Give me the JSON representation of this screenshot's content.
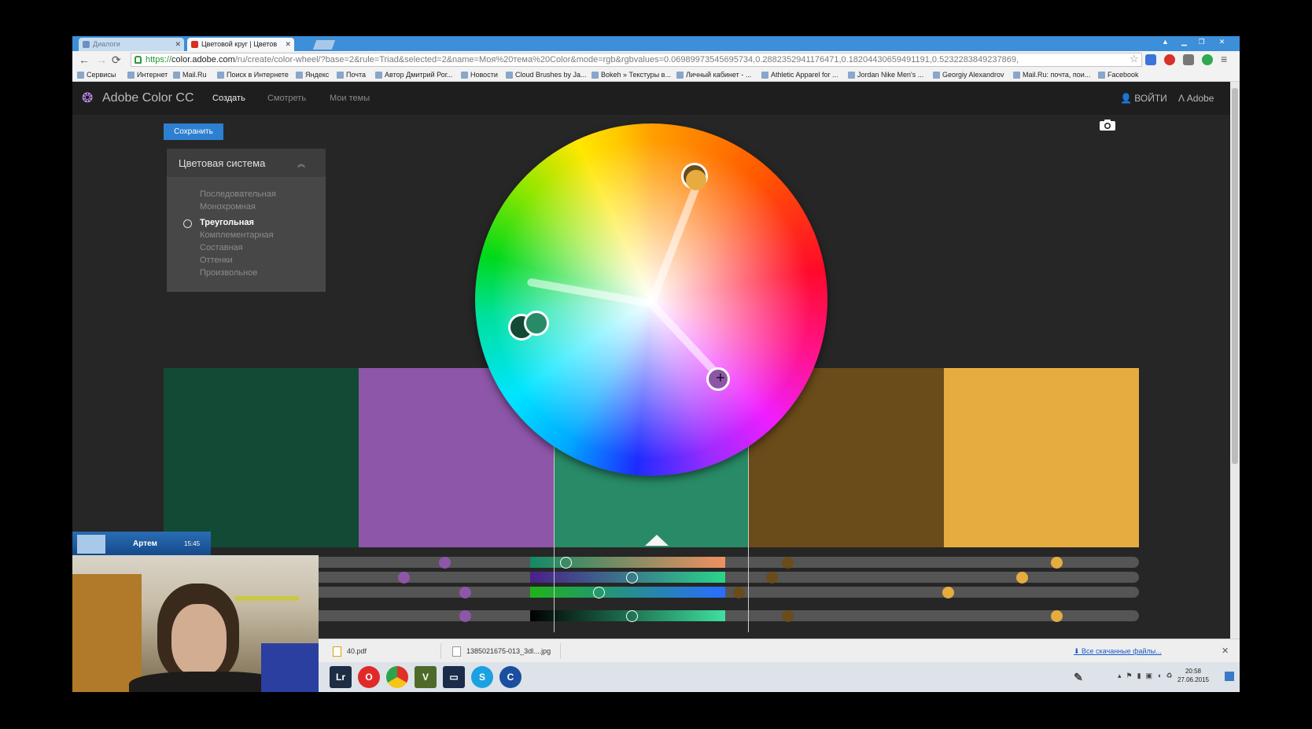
{
  "browser": {
    "tabs": [
      {
        "label": "Диалоги"
      },
      {
        "label": "Цветовой круг | Цветов"
      }
    ],
    "url_scheme": "https://",
    "url_host": "color.adobe.com",
    "url_rest": "/ru/create/color-wheel/?base=2&rule=Triad&selected=2&name=Моя%20тема%20Color&mode=rgb&rgbvalues=0.06989973545695734,0.2882352941176471,0.18204430659491191,0.5232283849237869,",
    "bookmarks": [
      "Сервисы",
      "Интернет",
      "Mail.Ru",
      "Поиск в Интернете",
      "Яндекс",
      "Почта",
      "Автор Дмитрий Рог...",
      "Новости",
      "Cloud Brushes by Ja...",
      "Bokeh » Текстуры в...",
      "Личный кабинет - ...",
      "Athletic Apparel for ...",
      "Jordan Nike Men's ...",
      "Georgiy Alexandrov",
      "Mail.Ru: почта, пои...",
      "Facebook"
    ]
  },
  "app": {
    "logo": "Adobe Color CC",
    "nav": [
      "Создать",
      "Смотреть",
      "Мои темы"
    ],
    "login": "ВОЙТИ",
    "adobe": "Adobe",
    "save_label": "Сохранить",
    "panel_title": "Цветовая система",
    "rules": [
      "Последовательная",
      "Монохромная",
      "Треугольная",
      "Комплементарная",
      "Составная",
      "Оттенки",
      "Произвольное"
    ],
    "selected_rule": "Треугольная"
  },
  "swatch_colors": [
    "#134a36",
    "#8d56a9",
    "#288a66",
    "#6a4b1a",
    "#e6ac40"
  ],
  "selected_swatch_index": 2,
  "call": {
    "name": "Артем",
    "time": "15:45"
  },
  "downloads": [
    {
      "name": "40.pdf"
    },
    {
      "name": "1385021675-013_3dl....jpg"
    }
  ],
  "downloads_all": "Все скачанные файлы...",
  "clock": {
    "time": "20:58",
    "date": "27.06.2015"
  },
  "taskbar_icons": [
    "lightroom-icon",
    "opera-icon",
    "chrome-icon",
    "vectorworks-icon",
    "monitor-icon",
    "skype-icon",
    "ccleaner-icon"
  ]
}
